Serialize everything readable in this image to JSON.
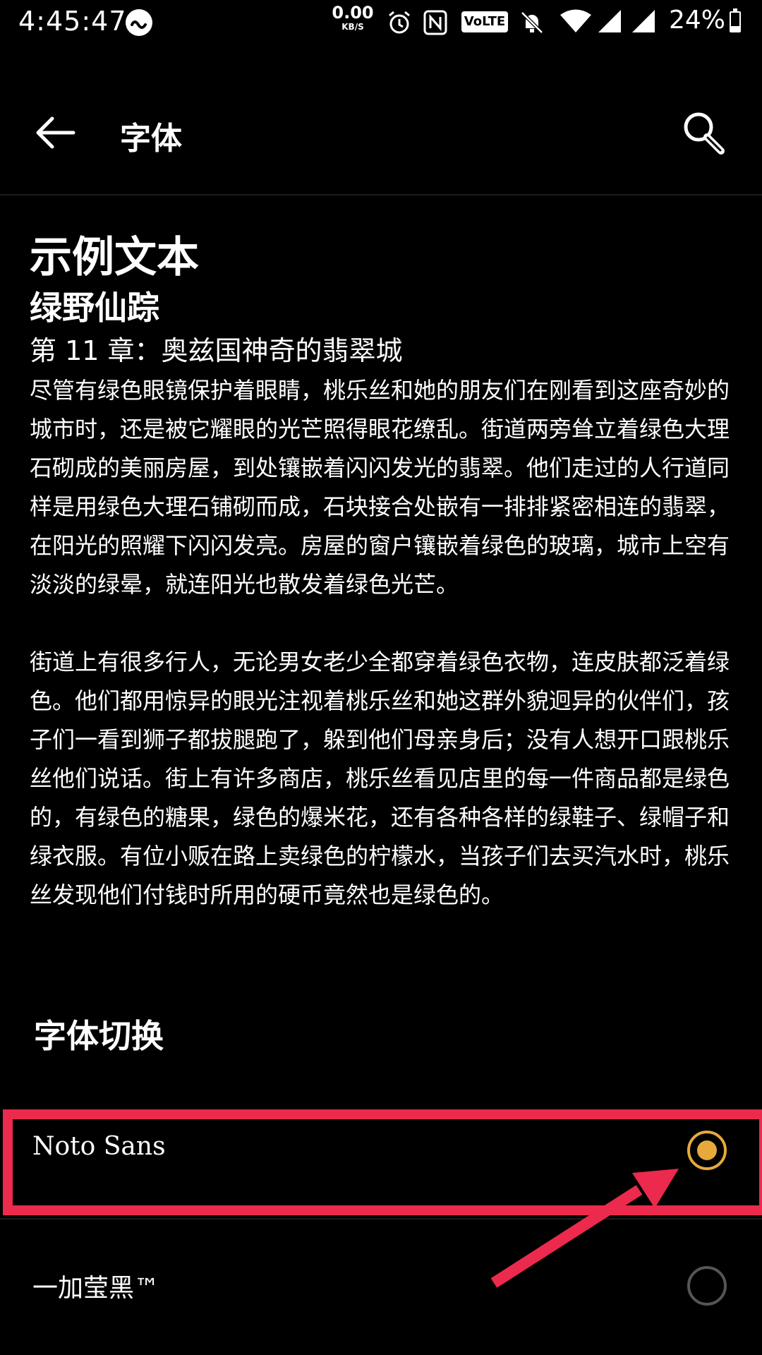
{
  "status_bar": {
    "time": "4:45:47",
    "net_speed_value": "0.00",
    "net_speed_unit": "KB/S",
    "volte": "VoLTE",
    "battery": "24%",
    "battery_level": 0.24
  },
  "app_bar": {
    "title": "字体",
    "back_icon": "arrow-left-icon",
    "search_icon": "search-icon"
  },
  "sample": {
    "h1": "示例文本",
    "h2": "绿野仙踪",
    "h3": "第 11 章：奥兹国神奇的翡翠城",
    "paragraphs": [
      "尽管有绿色眼镜保护着眼睛，桃乐丝和她的朋友们在刚看到这座奇妙的城市时，还是被它耀眼的光芒照得眼花缭乱。街道两旁耸立着绿色大理石砌成的美丽房屋，到处镶嵌着闪闪发光的翡翠。他们走过的人行道同样是用绿色大理石铺砌而成，石块接合处嵌有一排排紧密相连的翡翠，在阳光的照耀下闪闪发亮。房屋的窗户镶嵌着绿色的玻璃，城市上空有淡淡的绿晕，就连阳光也散发着绿色光芒。",
      "街道上有很多行人，无论男女老少全都穿着绿色衣物，连皮肤都泛着绿色。他们都用惊异的眼光注视着桃乐丝和她这群外貌迥异的伙伴们，孩子们一看到狮子都拔腿跑了，躲到他们母亲身后；没有人想开口跟桃乐丝他们说话。街上有许多商店，桃乐丝看见店里的每一件商品都是绿色的，有绿色的糖果，绿色的爆米花，还有各种各样的绿鞋子、绿帽子和绿衣服。有位小贩在路上卖绿色的柠檬水，当孩子们去买汽水时，桃乐丝发现他们付钱时所用的硬币竟然也是绿色的。"
    ]
  },
  "font_switch": {
    "title": "字体切换",
    "options": [
      {
        "label": "Noto Sans",
        "selected": true
      },
      {
        "label": "一加莹黑™",
        "selected": false
      }
    ]
  },
  "colors": {
    "accent": "#e7a93c",
    "annotation": "#ec2a4d",
    "background": "#000000"
  }
}
